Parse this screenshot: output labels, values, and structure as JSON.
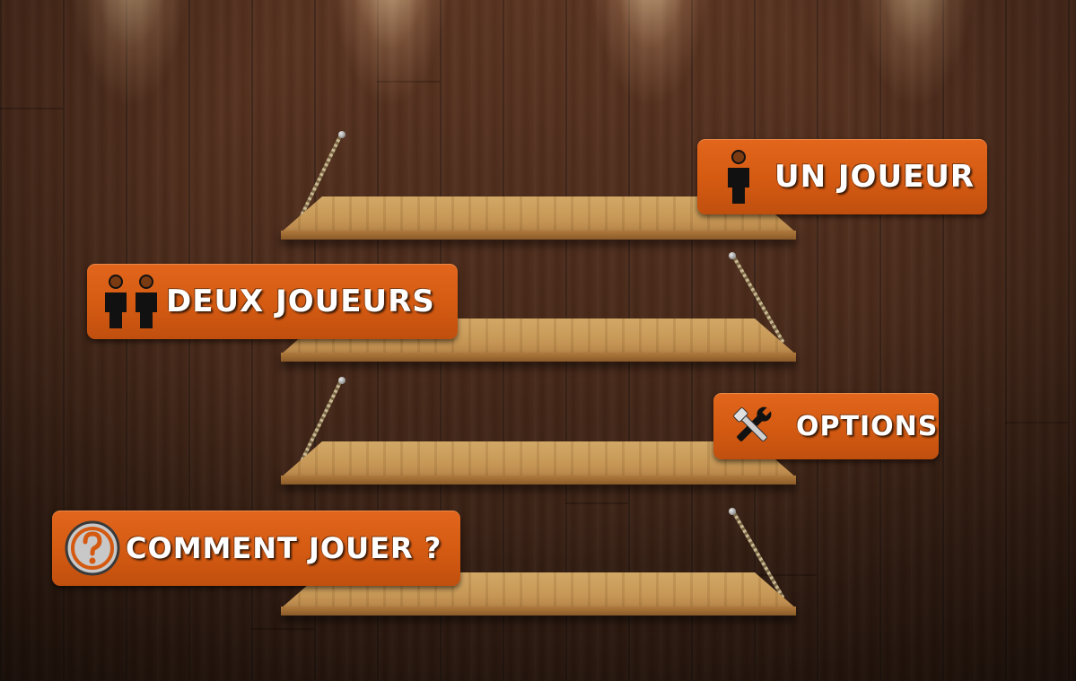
{
  "menu": {
    "items": [
      {
        "label": "UN JOUEUR",
        "icon": "single-player-icon"
      },
      {
        "label": "DEUX JOUEURS",
        "icon": "two-players-icon"
      },
      {
        "label": "OPTIONS",
        "icon": "tools-icon"
      },
      {
        "label": "COMMENT JOUER ?",
        "icon": "question-icon"
      }
    ]
  },
  "colors": {
    "button": "#d45a12",
    "wall": "#4a2a1a",
    "shelf": "#c89a58",
    "icon_dark": "#111111"
  }
}
